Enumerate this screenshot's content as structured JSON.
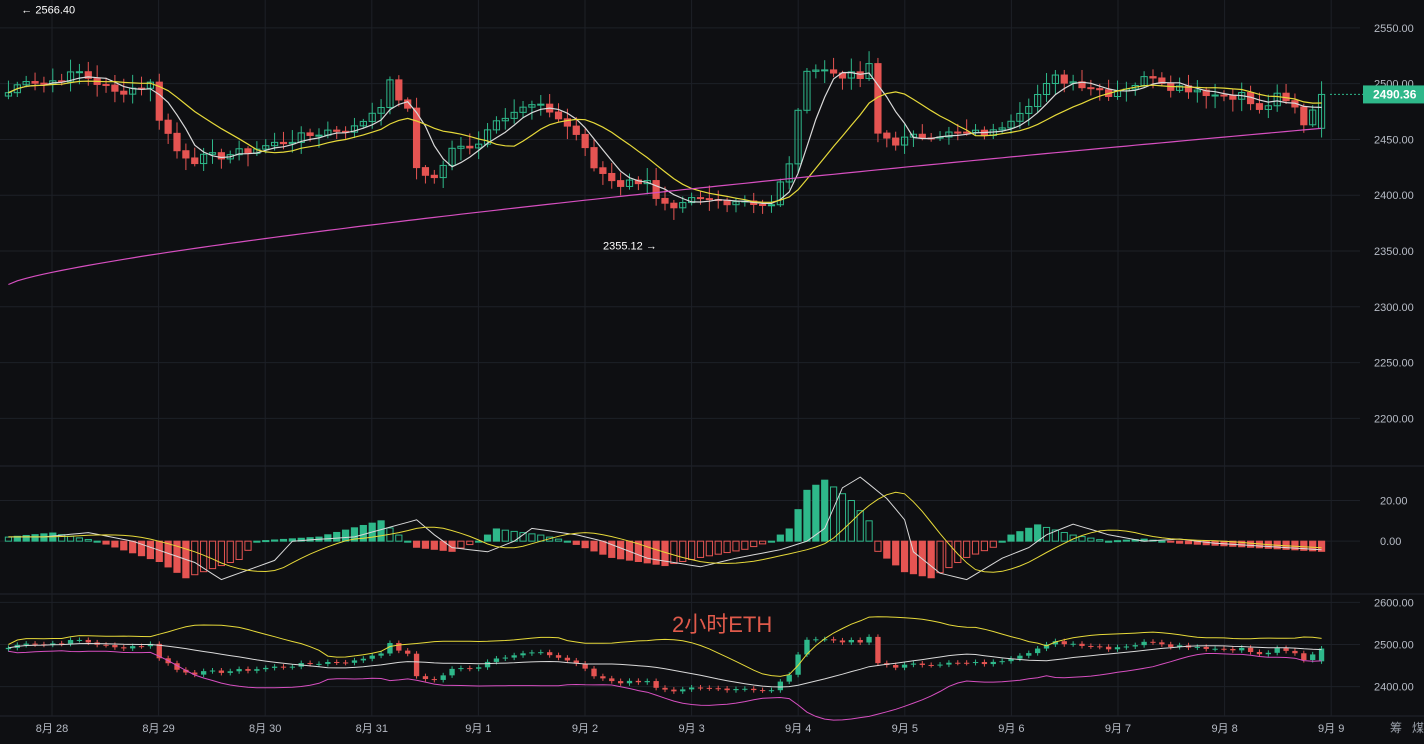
{
  "colors": {
    "background": "#0e0f12",
    "up": "#2eb88a",
    "down": "#e55452",
    "ma_fast": "#d9d9d9",
    "ma_mid": "#e6d93a",
    "ma_slow": "#d64fc0",
    "price_tag": "#2eb88a",
    "watermark": "#e05a4b"
  },
  "watermark": "2小时ETH",
  "price_tag": "2490.36",
  "x_labels": [
    "8月 28",
    "8月 29",
    "8月 30",
    "8月 31",
    "9月 1",
    "9月 2",
    "9月 3",
    "9月 4",
    "9月 5",
    "9月 6",
    "9月 7",
    "9月 8",
    "9月 9"
  ],
  "corner_icons": [
    "筹",
    "煤"
  ],
  "chart_data": [
    {
      "type": "candlestick",
      "panel": "price",
      "y_ticks": [
        "2550.00",
        "2500.00",
        "2450.00",
        "2400.00",
        "2350.00",
        "2300.00",
        "2250.00",
        "2200.00"
      ],
      "ylim": [
        2160,
        2575
      ],
      "high_annotation": {
        "label": "2566.40",
        "value": 2566.4,
        "x_index": 1
      },
      "low_annotation": {
        "label": "2355.12",
        "value": 2355.12,
        "x_index": 74
      },
      "last_price": 2490.36,
      "anchors": [
        [
          0,
          2492
        ],
        [
          2,
          2505
        ],
        [
          4,
          2500
        ],
        [
          8,
          2510
        ],
        [
          12,
          2492
        ],
        [
          16,
          2500
        ],
        [
          17,
          2470
        ],
        [
          19,
          2440
        ],
        [
          21,
          2432
        ],
        [
          26,
          2438
        ],
        [
          31,
          2448
        ],
        [
          36,
          2458
        ],
        [
          39,
          2460
        ],
        [
          42,
          2482
        ],
        [
          43,
          2500
        ],
        [
          45,
          2475
        ],
        [
          46,
          2425
        ],
        [
          48,
          2415
        ],
        [
          50,
          2440
        ],
        [
          53,
          2448
        ],
        [
          55,
          2470
        ],
        [
          59,
          2480
        ],
        [
          61,
          2476
        ],
        [
          64,
          2455
        ],
        [
          66,
          2425
        ],
        [
          69,
          2410
        ],
        [
          72,
          2415
        ],
        [
          73,
          2395
        ],
        [
          75,
          2385
        ],
        [
          77,
          2395
        ],
        [
          80,
          2395
        ],
        [
          83,
          2396
        ],
        [
          86,
          2390
        ],
        [
          88,
          2430
        ],
        [
          90,
          2515
        ],
        [
          93,
          2510
        ],
        [
          96,
          2505
        ],
        [
          97,
          2515
        ],
        [
          98,
          2455
        ],
        [
          100,
          2448
        ],
        [
          104,
          2455
        ],
        [
          108,
          2455
        ],
        [
          111,
          2456
        ],
        [
          113,
          2470
        ],
        [
          116,
          2490
        ],
        [
          118,
          2505
        ],
        [
          121,
          2500
        ],
        [
          124,
          2492
        ],
        [
          127,
          2500
        ],
        [
          129,
          2508
        ],
        [
          131,
          2498
        ],
        [
          134,
          2495
        ],
        [
          136,
          2490
        ],
        [
          139,
          2490
        ],
        [
          141,
          2475
        ],
        [
          143,
          2488
        ],
        [
          145,
          2478
        ],
        [
          146,
          2465
        ],
        [
          148,
          2490
        ]
      ],
      "ma_fast_offsets": [
        -4,
        6
      ],
      "ma_mid_window": 12,
      "ma_slow_window": 60
    },
    {
      "type": "histogram",
      "panel": "macd",
      "y_ticks": [
        "20.00",
        "0.00"
      ],
      "ylim": [
        -25,
        35
      ],
      "anchors": [
        [
          0,
          2
        ],
        [
          5,
          4
        ],
        [
          10,
          0
        ],
        [
          17,
          -10
        ],
        [
          20,
          -18
        ],
        [
          26,
          -9
        ],
        [
          28,
          0
        ],
        [
          35,
          2
        ],
        [
          42,
          10
        ],
        [
          44,
          3
        ],
        [
          46,
          -3
        ],
        [
          50,
          -5
        ],
        [
          53,
          0
        ],
        [
          55,
          6
        ],
        [
          60,
          3
        ],
        [
          63,
          0
        ],
        [
          68,
          -8
        ],
        [
          74,
          -12
        ],
        [
          78,
          -8
        ],
        [
          83,
          -4
        ],
        [
          86,
          0
        ],
        [
          88,
          6
        ],
        [
          90,
          25
        ],
        [
          92,
          30
        ],
        [
          95,
          20
        ],
        [
          97,
          10
        ],
        [
          98,
          -5
        ],
        [
          101,
          -15
        ],
        [
          104,
          -18
        ],
        [
          108,
          -8
        ],
        [
          111,
          -3
        ],
        [
          113,
          3
        ],
        [
          116,
          8
        ],
        [
          120,
          3
        ],
        [
          124,
          0
        ],
        [
          128,
          1
        ],
        [
          132,
          -1
        ],
        [
          140,
          -3
        ],
        [
          148,
          -5
        ]
      ],
      "dif_shift": 4,
      "dea_window": 8
    },
    {
      "type": "line",
      "panel": "bollinger",
      "y_ticks": [
        "2600.00",
        "2500.00",
        "2400.00"
      ],
      "ylim": [
        2335,
        2615
      ],
      "series_count": 3
    }
  ]
}
